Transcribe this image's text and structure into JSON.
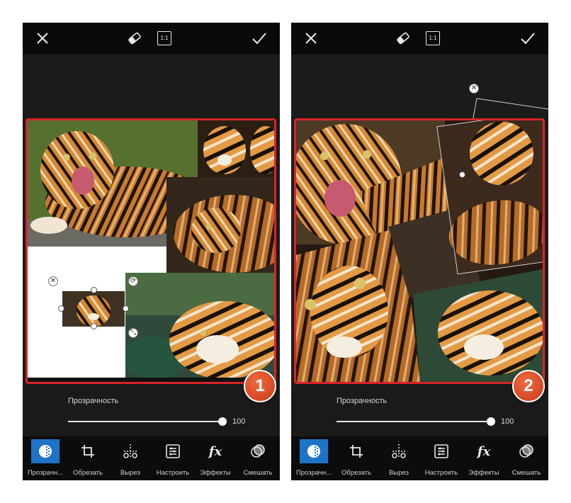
{
  "panels": [
    {
      "badge": "1",
      "topbar": {
        "close_icon": "close-icon",
        "eraser_icon": "eraser-icon",
        "ratio_label": "1:1",
        "confirm_icon": "check-icon"
      },
      "slider": {
        "label": "Прозрачность",
        "value": "100",
        "level": 1.0
      },
      "tools": [
        {
          "label": "Прозрачн...",
          "icon": "transparency-icon",
          "active": true
        },
        {
          "label": "Обрезать",
          "icon": "crop-icon",
          "active": false
        },
        {
          "label": "Вырез",
          "icon": "cutout-icon",
          "active": false
        },
        {
          "label": "Настроить",
          "icon": "adjust-icon",
          "active": false
        },
        {
          "label": "Эффекты",
          "icon": "fx-icon",
          "active": false
        },
        {
          "label": "Смешать",
          "icon": "blend-icon",
          "active": false
        }
      ]
    },
    {
      "badge": "2",
      "topbar": {
        "close_icon": "close-icon",
        "eraser_icon": "eraser-icon",
        "ratio_label": "1:1",
        "confirm_icon": "check-icon"
      },
      "slider": {
        "label": "Прозрачность",
        "value": "100",
        "level": 1.0
      },
      "tools": [
        {
          "label": "Прозрачн...",
          "icon": "transparency-icon",
          "active": true
        },
        {
          "label": "Обрезать",
          "icon": "crop-icon",
          "active": false
        },
        {
          "label": "Вырез",
          "icon": "cutout-icon",
          "active": false
        },
        {
          "label": "Настроить",
          "icon": "adjust-icon",
          "active": false
        },
        {
          "label": "Эффекты",
          "icon": "fx-icon",
          "active": false
        },
        {
          "label": "Смешать",
          "icon": "blend-icon",
          "active": false
        }
      ]
    }
  ],
  "colors": {
    "highlight_frame": "#d9232a",
    "active_tool": "#1d74c7",
    "badge": "#e04e28",
    "tiger_orange": "#c9762a"
  }
}
